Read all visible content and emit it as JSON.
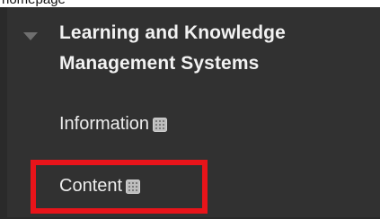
{
  "breadcrumb": {
    "text": "homepage"
  },
  "sidebar": {
    "course_title": "Learning and Knowledge Management Systems",
    "items": [
      {
        "label": "Information",
        "icon": "menu-grid-icon"
      },
      {
        "label": "Content",
        "icon": "menu-grid-icon"
      }
    ]
  },
  "annotation": {
    "highlight_color": "#e8141a"
  },
  "colors": {
    "sidebar_background": "#313131",
    "text": "#ededed"
  }
}
